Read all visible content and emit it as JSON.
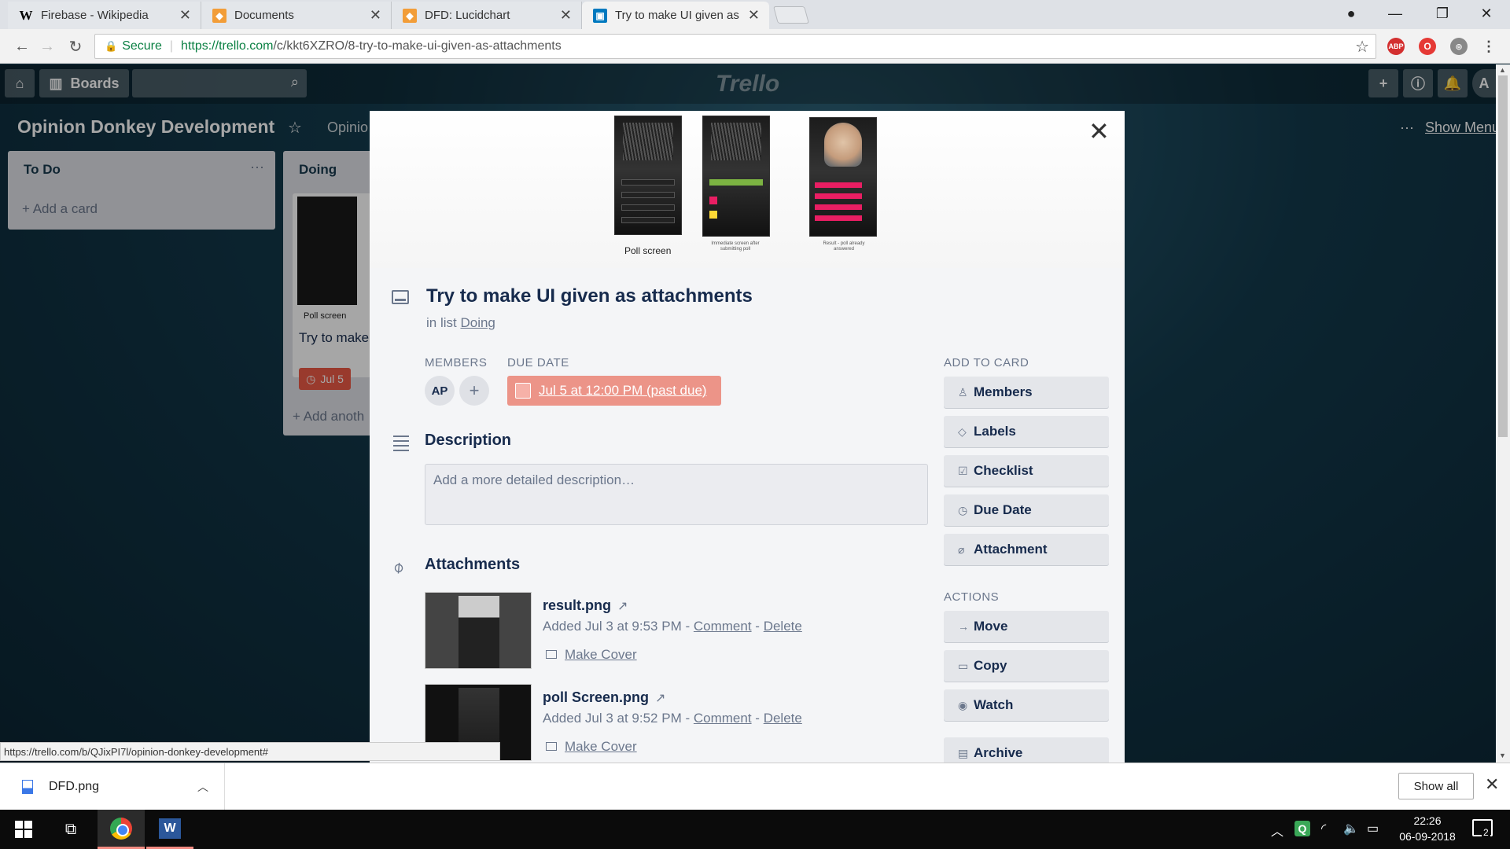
{
  "browser": {
    "tabs": [
      {
        "title": "Firebase - Wikipedia",
        "favicon": "W"
      },
      {
        "title": "Documents",
        "favicon": "◆"
      },
      {
        "title": "DFD: Lucidchart",
        "favicon": "◆"
      },
      {
        "title": "Try to make UI given as a",
        "favicon": "▣"
      }
    ],
    "secure_label": "Secure",
    "url_host": "https://trello.com",
    "url_path": "/c/kkt6XZRO/8-try-to-make-ui-given-as-attachments",
    "extensions": {
      "abp": "ABP",
      "opera": "O"
    }
  },
  "board": {
    "boards_label": "Boards",
    "logo": "Trello",
    "title": "Opinion Donkey Development",
    "team": "Opinio",
    "show_menu": "Show Menu",
    "lists": [
      {
        "title": "To Do",
        "add_card": "+ Add a card"
      },
      {
        "title": "Doing",
        "card_caption": "Poll screen",
        "card_title": "Try to make",
        "due": "Jul 5",
        "add_another": "+ Add anoth"
      }
    ]
  },
  "card": {
    "cover": {
      "caption_poll": "Poll screen",
      "caption_immediate": "Immediate screen after submitting poll",
      "caption_result": "Result - poll already answered"
    },
    "title": "Try to make UI given as attachments",
    "in_list_prefix": "in list",
    "in_list_name": "Doing",
    "members_label": "MEMBERS",
    "member_initials": "AP",
    "add_member": "+",
    "due_date_label": "DUE DATE",
    "due_date": "Jul 5 at 12:00 PM (past due)",
    "description_label": "Description",
    "description_placeholder": "Add a more detailed description…",
    "attachments_label": "Attachments",
    "attachments": [
      {
        "name": "result.png",
        "added": "Added Jul 3 at 9:53 PM",
        "sep": "-",
        "comment": "Comment",
        "delete": "Delete",
        "make_cover": "Make Cover"
      },
      {
        "name": "poll Screen.png",
        "added": "Added Jul 3 at 9:52 PM",
        "sep": "-",
        "comment": "Comment",
        "delete": "Delete",
        "make_cover": "Make Cover"
      }
    ],
    "add_to_card_label": "ADD TO CARD",
    "add_to_card": [
      {
        "label": "Members",
        "icon": "person-icon"
      },
      {
        "label": "Labels",
        "icon": "tag-icon"
      },
      {
        "label": "Checklist",
        "icon": "checkbox-icon"
      },
      {
        "label": "Due Date",
        "icon": "clock-icon"
      },
      {
        "label": "Attachment",
        "icon": "paperclip-icon"
      }
    ],
    "actions_label": "ACTIONS",
    "actions": [
      {
        "label": "Move",
        "icon": "arrow-right-icon"
      },
      {
        "label": "Copy",
        "icon": "card-icon"
      },
      {
        "label": "Watch",
        "icon": "eye-icon"
      },
      {
        "label": "Archive",
        "icon": "archive-icon"
      }
    ]
  },
  "status_url": "https://trello.com/b/QJixPI7l/opinion-donkey-development#",
  "downloads": {
    "file": "DFD.png",
    "show_all": "Show all"
  },
  "taskbar": {
    "time": "22:26",
    "date": "06-09-2018",
    "notifications": "2"
  },
  "colors": {
    "due_past": "#ec9488",
    "board_bg": "#133a4c",
    "trello_text": "#172b4d"
  }
}
